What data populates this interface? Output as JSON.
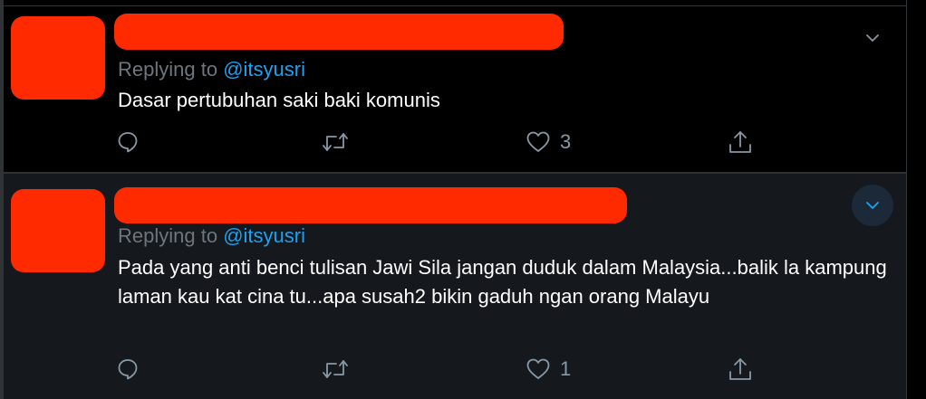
{
  "tweets": [
    {
      "reply_prefix": "Replying to",
      "reply_handle": "@itsyusri",
      "text": "Dasar pertubuhan saki baki komunis",
      "like_count": "3"
    },
    {
      "reply_prefix": "Replying to",
      "reply_handle": "@itsyusri",
      "text": "Pada yang anti benci tulisan Jawi Sila jangan duduk dalam Malaysia...balik la kampung laman kau kat cina tu...apa susah2 bikin gaduh ngan orang Malayu",
      "like_count": "1"
    }
  ],
  "colors": {
    "background": "#000000",
    "hover_background": "#15181c",
    "redaction": "#ff2a00",
    "link": "#1da1f2",
    "muted_text": "#6e767d",
    "icon": "#8899a6"
  },
  "icons": {
    "caret": "chevron-down-icon",
    "reply": "reply-icon",
    "retweet": "retweet-icon",
    "like": "heart-icon",
    "share": "share-icon"
  }
}
